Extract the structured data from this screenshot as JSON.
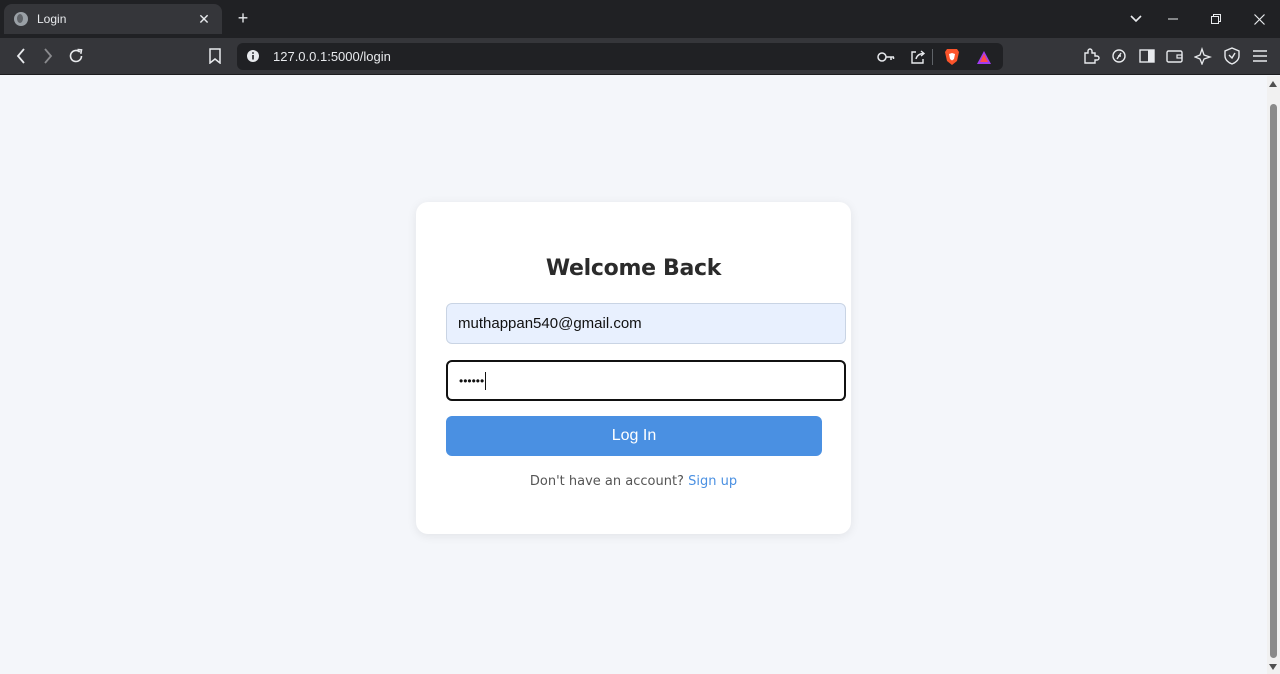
{
  "browser": {
    "tab": {
      "title": "Login",
      "favicon": "globe-icon"
    },
    "address": {
      "url": "127.0.0.1:5000/login"
    }
  },
  "login": {
    "heading": "Welcome Back",
    "email_value": "muthappan540@gmail.com",
    "password_mask": "••••••",
    "button_label": "Log In",
    "signup_prompt": "Don't have an account?",
    "signup_link": "Sign up"
  },
  "colors": {
    "accent": "#4a90e2",
    "page_bg": "#f4f6fa",
    "autofill_bg": "#e8f0fe",
    "browser_chrome": "#35363a"
  }
}
